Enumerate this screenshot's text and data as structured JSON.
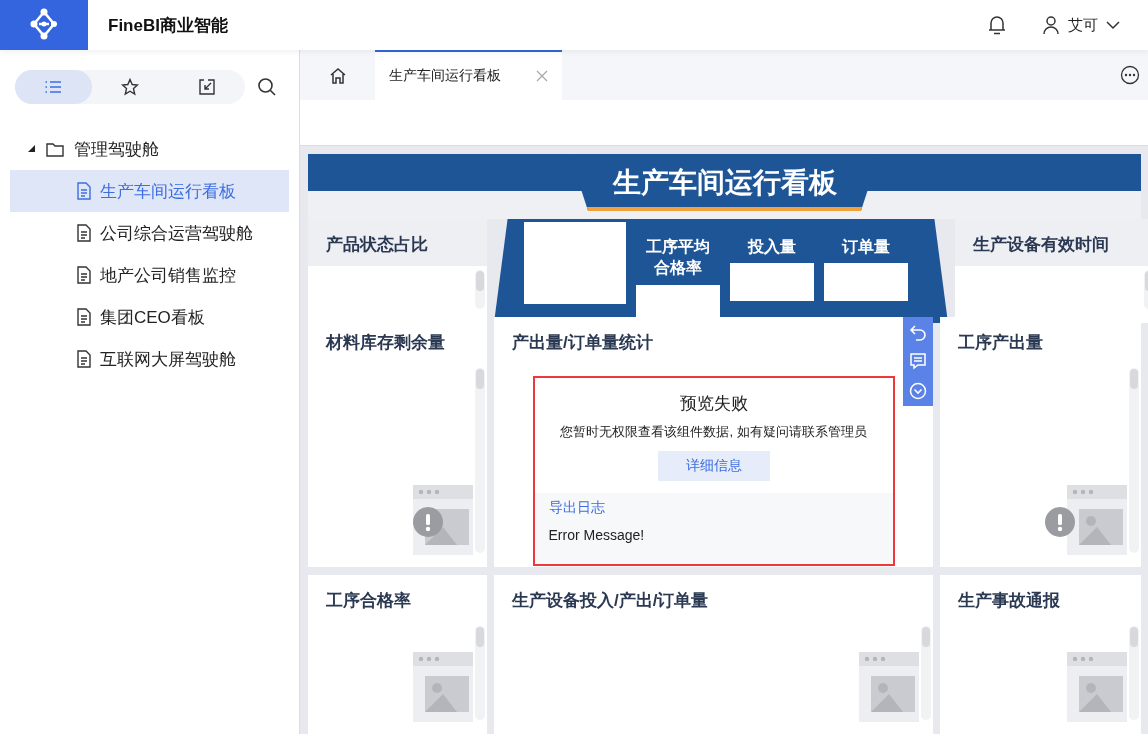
{
  "app": {
    "title": "FineBI商业智能",
    "user": "艾可"
  },
  "sidebar": {
    "view_tabs": [
      {
        "kind": "list",
        "selected": true
      },
      {
        "kind": "favorites",
        "selected": false
      },
      {
        "kind": "import",
        "selected": false
      }
    ],
    "tree": {
      "label": "管理驾驶舱",
      "expanded": true,
      "children": [
        {
          "label": "生产车间运行看板",
          "selected": true
        },
        {
          "label": "公司综合运营驾驶舱",
          "selected": false
        },
        {
          "label": "地产公司销售监控",
          "selected": false
        },
        {
          "label": "集团CEO看板",
          "selected": false
        },
        {
          "label": "互联网大屏驾驶舱",
          "selected": false
        }
      ]
    }
  },
  "tabs": [
    {
      "kind": "home",
      "selected": false
    },
    {
      "kind": "page",
      "label": "生产车间运行看板",
      "selected": true
    }
  ],
  "dashboard": {
    "title": "生产车间运行看板",
    "rows": [
      [
        {
          "kind": "empty",
          "title": "产品状态占比",
          "warning": false
        },
        {
          "kind": "kpi",
          "kpis": [
            {
              "label": "工序平均合格率"
            },
            {
              "label": "投入量"
            },
            {
              "label": "订单量"
            }
          ]
        },
        {
          "kind": "empty",
          "title": "生产设备有效时间",
          "warning": false
        }
      ],
      [
        {
          "kind": "empty",
          "title": "材料库存剩余量",
          "warning": true
        },
        {
          "kind": "error",
          "title": "产出量/订单量统计",
          "error": {
            "title": "预览失败",
            "message": "您暂时无权限查看该组件数据, 如有疑问请联系管理员",
            "details_button": "详细信息",
            "export_link": "导出日志",
            "log": "Error Message!"
          }
        },
        {
          "kind": "empty",
          "title": "工序产出量",
          "warning": true
        }
      ],
      [
        {
          "kind": "empty",
          "title": "工序合格率",
          "warning": false
        },
        {
          "kind": "empty",
          "title": "生产设备投入/产出/订单量",
          "warning": false
        },
        {
          "kind": "empty",
          "title": "生产事故通报",
          "warning": false
        }
      ]
    ]
  }
}
